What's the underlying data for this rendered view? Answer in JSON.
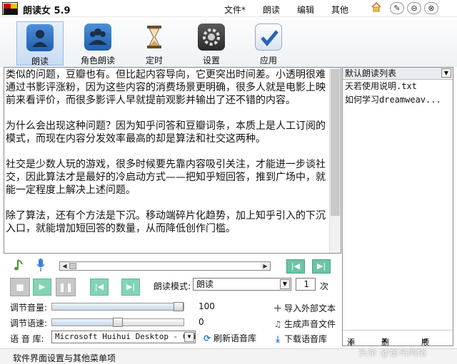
{
  "titlebar": {
    "title": "朗读女 5.9",
    "menus": [
      "文件*",
      "朗读",
      "编辑",
      "其他"
    ],
    "window_buttons": [
      "pin-icon",
      "minimize-icon",
      "close-icon"
    ]
  },
  "toolbar": {
    "items": [
      {
        "label": "朗读",
        "icon": "reader-icon",
        "active": true
      },
      {
        "label": "角色朗读",
        "icon": "roles-icon",
        "active": false
      },
      {
        "label": "定时",
        "icon": "hourglass-icon",
        "active": false
      },
      {
        "label": "设置",
        "icon": "gear-icon",
        "active": false
      },
      {
        "label": "应用",
        "icon": "checkmark-icon",
        "active": false
      }
    ]
  },
  "text_area": {
    "paragraphs": [
      "类似的问题，豆瓣也有。但比起内容导向，它更突出时间差。小透明很难通过书影评涨粉，因为这些内容的消费场景更明确，很多人就是电影上映前来看评价，而很多影评人早就提前观影并输出了还不错的内容。",
      "为什么会出现这种问题？因为知乎问答和豆瓣词条，本质上是人工订阅的模式，而现在内容分发效率最高的却是算法和社交这两种。",
      "社交是少数人玩的游戏，很多时候要先靠内容吸引关注，才能进一步谈社交，因此算法才是最好的冷启动方式——把知乎短回答，推到广场中，就能一定程度上解决上述问题。",
      "除了算法，还有个方法是下沉。移动端碎片化趋势，加上知乎引入的下沉入口，就能增加短回答的数量，从而降低创作门槛。"
    ]
  },
  "playlist": {
    "title": "默认朗读列表",
    "items": [
      "天若使用说明.txt",
      "如何学习dreamweav..."
    ],
    "add_label": "添加",
    "delete_label": "删除",
    "order_label": "顺序"
  },
  "playback": {
    "mode_label": "朗读模式:",
    "mode_value": "朗读",
    "repeat_value": "1",
    "repeat_unit": "次"
  },
  "settings": {
    "volume_label": "调节音量:",
    "volume_value": "100",
    "volume_level": 1.0,
    "speed_label": "调节语速:",
    "speed_value": "0",
    "speed_level": 0.5,
    "voice_label": "语 音 库:",
    "voice_value": "Microsoft Huihui Desktop - Chines",
    "refresh_label": "刷新语音库",
    "import_label": "导入外部文本",
    "generate_audio_label": "生成声音文件",
    "download_voice_label": "下载语音库"
  },
  "statusbar": {
    "text": "软件界面设置与其他菜单项"
  },
  "watermark": "头条 @金鸟网络",
  "colors": {
    "accent_green": "#6cc4a6",
    "active_tab": "#c8dcf4",
    "link_blue": "#1a66cc"
  }
}
